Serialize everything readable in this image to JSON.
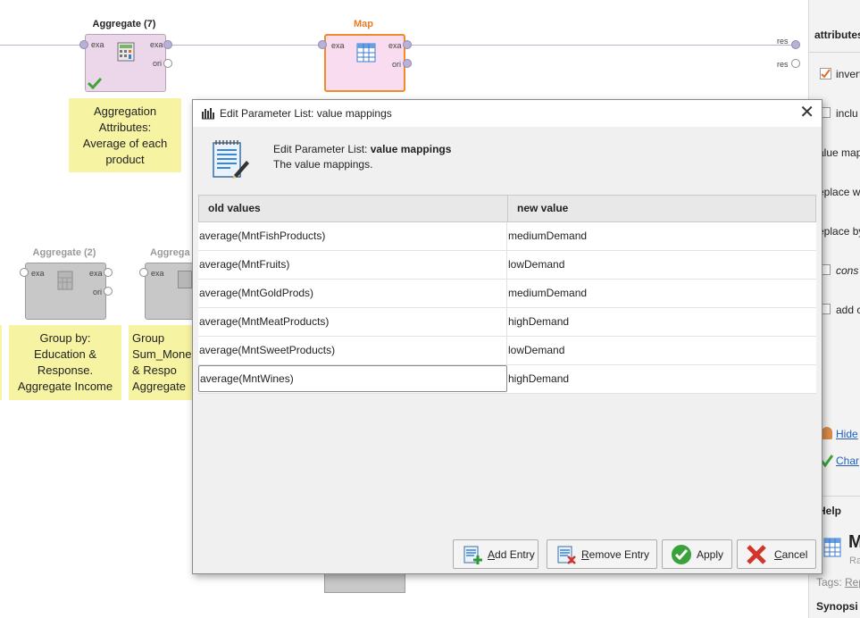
{
  "canvas": {
    "operators": [
      {
        "id": "aggregate-7",
        "title": "Aggregate (7)",
        "ports_in": [
          "exa"
        ],
        "ports_out": [
          "exa",
          "ori"
        ]
      },
      {
        "id": "map",
        "title": "Map",
        "ports_in": [
          "exa"
        ],
        "ports_out": [
          "exa",
          "ori"
        ]
      },
      {
        "id": "aggregate-2",
        "title": "Aggregate (2)",
        "ports_in": [
          "exa"
        ],
        "ports_out": [
          "exa",
          "ori"
        ]
      },
      {
        "id": "aggregate-3",
        "title": "Aggrega",
        "ports_in": [
          "exa"
        ],
        "ports_out": []
      }
    ],
    "result_ports": [
      "res",
      "res"
    ],
    "notes": [
      "Aggregation Attributes: Average of each product",
      "Group by: Education & Response. Aggregate Income",
      "Group Sum_Mone & Respo Aggregate"
    ],
    "colors": {
      "active_operator": "#ecd7ea",
      "selected_border": "#f08a2a",
      "note": "#f6f3a2",
      "port": "#b8b3d4"
    }
  },
  "side_panel": {
    "header": "attributes",
    "items": [
      "invert",
      "inclu",
      "alue map",
      "eplace w",
      "eplace by",
      "cons",
      "add c"
    ],
    "links": [
      "Hide",
      "Char"
    ],
    "help_title": "Help",
    "help_big": "M",
    "help_small": "Ra",
    "tags_label": "Tags:",
    "tags_link": "Rep",
    "synopsis": "Synopsi"
  },
  "dialog": {
    "title": "Edit Parameter List: value mappings",
    "header_prefix": "Edit Parameter List: ",
    "header_bold": "value mappings",
    "description": "The value mappings.",
    "columns": [
      "old values",
      "new value"
    ],
    "rows": [
      {
        "old": "average(MntFishProducts)",
        "new": "mediumDemand"
      },
      {
        "old": "average(MntFruits)",
        "new": "lowDemand"
      },
      {
        "old": "average(MntGoldProds)",
        "new": "mediumDemand"
      },
      {
        "old": "average(MntMeatProducts)",
        "new": "highDemand"
      },
      {
        "old": "average(MntSweetProducts)",
        "new": "lowDemand"
      },
      {
        "old": "average(MntWines)",
        "new": "highDemand"
      }
    ],
    "buttons": {
      "add_entry": {
        "label_mn": "A",
        "label_rest": "dd Entry"
      },
      "remove_entry": {
        "label_mn": "R",
        "label_rest": "emove Entry"
      },
      "apply": {
        "label": "Apply"
      },
      "cancel": {
        "label_mn": "C",
        "label_rest": "ancel"
      }
    },
    "icons": [
      "notepad-icon",
      "close-icon",
      "add-entry-icon",
      "remove-entry-icon",
      "apply-check-icon",
      "cancel-x-icon"
    ]
  }
}
